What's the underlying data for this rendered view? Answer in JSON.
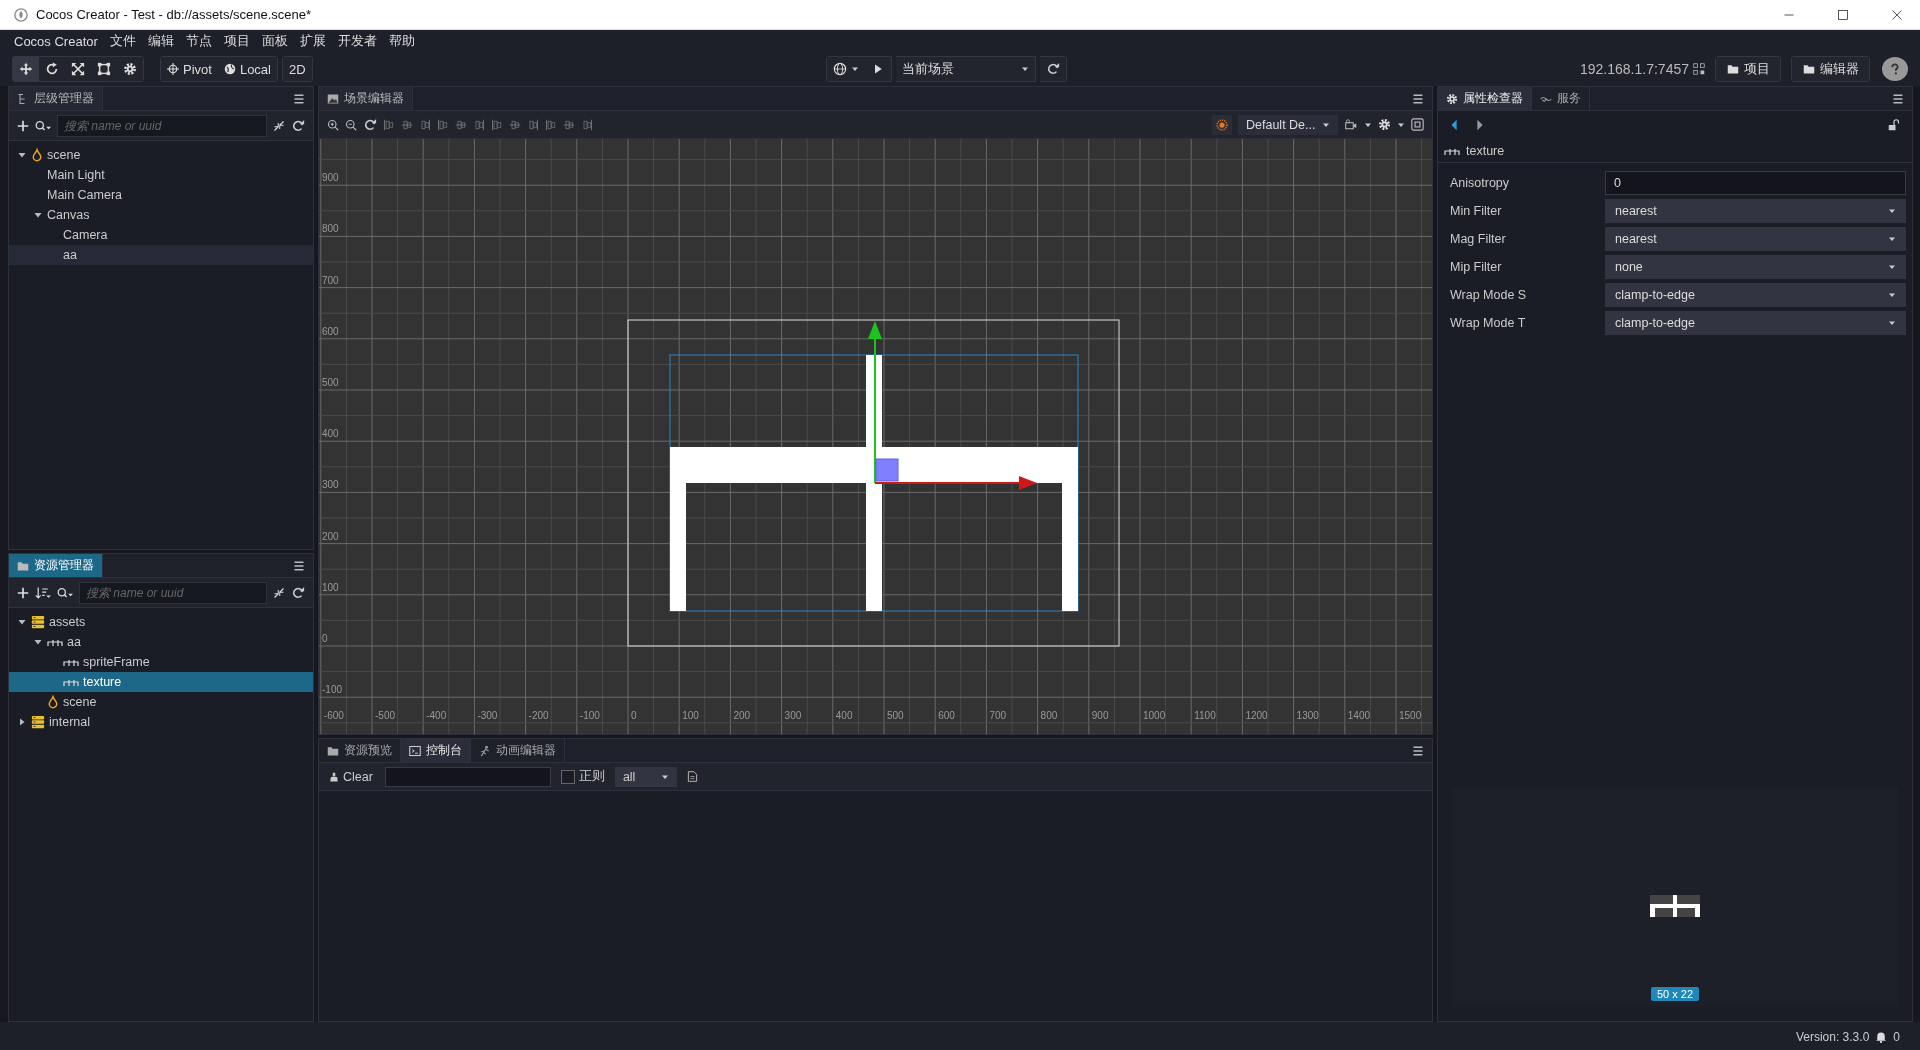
{
  "window": {
    "title": "Cocos Creator - Test - db://assets/scene.scene*"
  },
  "menu": [
    "Cocos Creator",
    "文件",
    "编辑",
    "节点",
    "项目",
    "面板",
    "扩展",
    "开发者",
    "帮助"
  ],
  "toolbar": {
    "tools": [
      {
        "kind": "move",
        "selected": true
      },
      {
        "kind": "rotate",
        "selected": false
      },
      {
        "kind": "scale",
        "selected": false
      },
      {
        "kind": "rect",
        "selected": false
      },
      {
        "kind": "gear",
        "selected": false
      }
    ],
    "pivot": "Pivot",
    "local": "Local",
    "mode_2d": "2D",
    "scene_select": "当前场景",
    "ip": "192.168.1.7:7457",
    "buttons": [
      "项目",
      "编辑器"
    ]
  },
  "hierarchy": {
    "title": "层级管理器",
    "focused": false,
    "search_placeholder": "搜索 name or uuid",
    "tree": [
      {
        "label": "scene",
        "kind": "scene",
        "selected": false,
        "expanded": true,
        "children": [
          {
            "label": "Main Light",
            "selected": false
          },
          {
            "label": "Main Camera",
            "selected": false
          },
          {
            "label": "Canvas",
            "selected": false,
            "expanded": true,
            "children": [
              {
                "label": "Camera",
                "selected": false
              },
              {
                "label": "aa",
                "selected": true
              }
            ]
          }
        ]
      }
    ]
  },
  "assets": {
    "title": "资源管理器",
    "focused": true,
    "search_placeholder": "搜索 name or uuid",
    "tree": [
      {
        "label": "assets",
        "kind": "folder",
        "selected": false,
        "expanded": true,
        "children": [
          {
            "label": "aa",
            "kind": "image",
            "selected": false,
            "expanded": true,
            "children": [
              {
                "label": "spriteFrame",
                "kind": "image",
                "selected": false
              },
              {
                "label": "texture",
                "kind": "image",
                "selected": true
              }
            ]
          },
          {
            "label": "scene",
            "kind": "scene",
            "selected": false
          }
        ]
      },
      {
        "label": "internal",
        "kind": "folder",
        "selected": false,
        "expanded": false
      }
    ]
  },
  "scene_editor": {
    "title": "场景编辑器",
    "focused": false,
    "camera_select": "Default De...",
    "y_labels": [
      "900",
      "800",
      "700",
      "600",
      "500",
      "400",
      "300",
      "200",
      "100",
      "0",
      "-100"
    ],
    "x_labels": [
      "-600",
      "-500",
      "-400",
      "-300",
      "-200",
      "-100",
      "0",
      "100",
      "200",
      "300",
      "400",
      "500",
      "600",
      "700",
      "800",
      "900",
      "1000",
      "1100",
      "1200",
      "1300",
      "1400",
      "1500"
    ]
  },
  "console": {
    "tabs": [
      {
        "label": "资源预览",
        "selected": false
      },
      {
        "label": "控制台",
        "selected": true
      },
      {
        "label": "动画编辑器",
        "selected": false
      }
    ],
    "clear": "Clear",
    "regex_label": "正则",
    "regex_checked": false,
    "level_select": "all"
  },
  "inspector": {
    "tabs": [
      {
        "label": "属性检查器",
        "selected": true
      },
      {
        "label": "服务",
        "selected": false
      }
    ],
    "asset_name": "texture",
    "properties": [
      {
        "label": "Anisotropy",
        "kind": "number",
        "value": "0"
      },
      {
        "label": "Min Filter",
        "kind": "select",
        "value": "nearest"
      },
      {
        "label": "Mag Filter",
        "kind": "select",
        "value": "nearest"
      },
      {
        "label": "Mip Filter",
        "kind": "select",
        "value": "none"
      },
      {
        "label": "Wrap Mode S",
        "kind": "select",
        "value": "clamp-to-edge"
      },
      {
        "label": "Wrap Mode T",
        "kind": "select",
        "value": "clamp-to-edge"
      }
    ],
    "preview_size": "50 x 22"
  },
  "status_bar": {
    "version": "Version: 3.3.0",
    "notifications": "0"
  }
}
